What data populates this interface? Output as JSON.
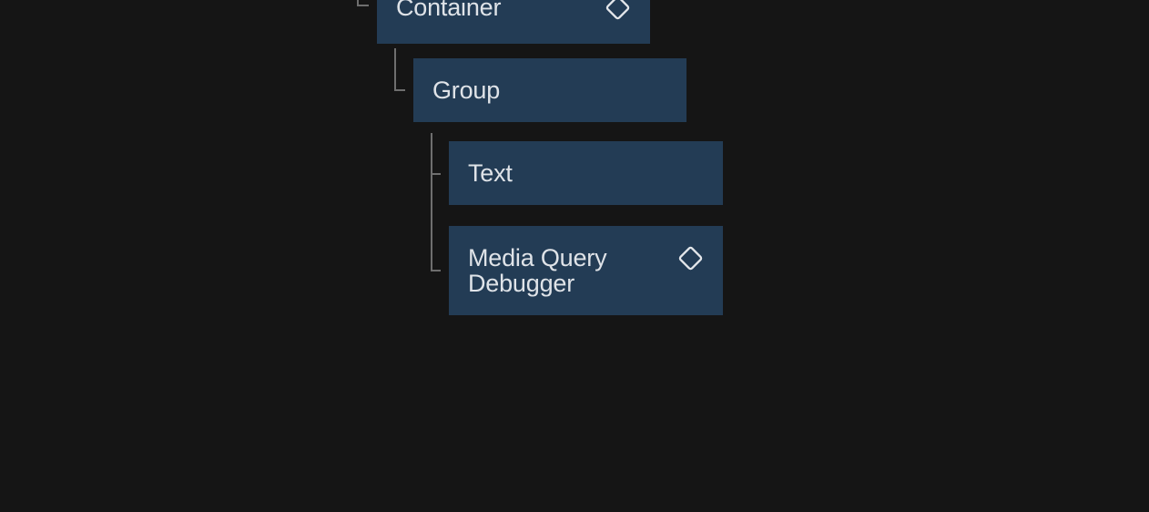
{
  "app": {
    "name": "layers-panel",
    "description": "Dark layer tree panel with nested layer rows"
  },
  "colors": {
    "background": "#151515",
    "node_background": "#233c55",
    "node_text": "#dfe3e8",
    "connector_line": "#6e6e6e",
    "icon": "#e4e7eb"
  },
  "tree": {
    "nodes": [
      {
        "label": "Container",
        "icon": "component-diamond",
        "depth": 0,
        "lines": 1
      },
      {
        "label": "Group",
        "icon": null,
        "depth": 1,
        "lines": 1
      },
      {
        "label": "Text",
        "icon": null,
        "depth": 2,
        "lines": 1
      },
      {
        "label": "Media Query Debugger",
        "icon": "component-diamond",
        "depth": 2,
        "lines": 2
      }
    ]
  }
}
